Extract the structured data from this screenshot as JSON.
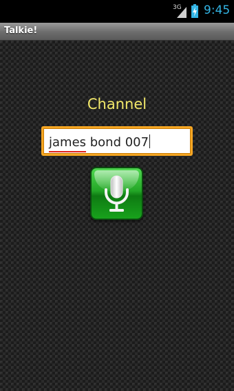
{
  "status_bar": {
    "network_type": "3G",
    "time": "9:45",
    "signal_icon": "signal-icon",
    "battery_icon": "battery-charging-icon"
  },
  "app": {
    "title": "Talkie!"
  },
  "channel": {
    "label": "Channel",
    "value": "james bond 007"
  },
  "mic_button": {
    "icon": "microphone-icon",
    "color": "#23a626"
  },
  "colors": {
    "label": "#f2e86a",
    "input_border": "#f5a623",
    "clock": "#33b5e5"
  }
}
